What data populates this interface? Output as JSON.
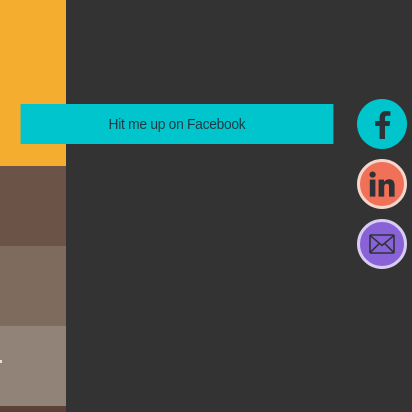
{
  "side_strip": {
    "colors": [
      "#f4ad2f",
      "#6b5447",
      "#7f6a5e",
      "#918377",
      "#5a4036"
    ]
  },
  "tooltip": {
    "label": "Hit me up on Facebook",
    "background": "#00c5cc",
    "text_color": "#1f3a45"
  },
  "social": {
    "facebook": {
      "icon": "facebook-icon",
      "background": "#00c5cc",
      "glyph_color": "#2e3236"
    },
    "linkedin": {
      "icon": "linkedin-icon",
      "background": "#f07058",
      "glyph_color": "#2e3236"
    },
    "email": {
      "icon": "envelope-icon",
      "background": "#8a62d8",
      "glyph_color": "#2e3236"
    }
  }
}
